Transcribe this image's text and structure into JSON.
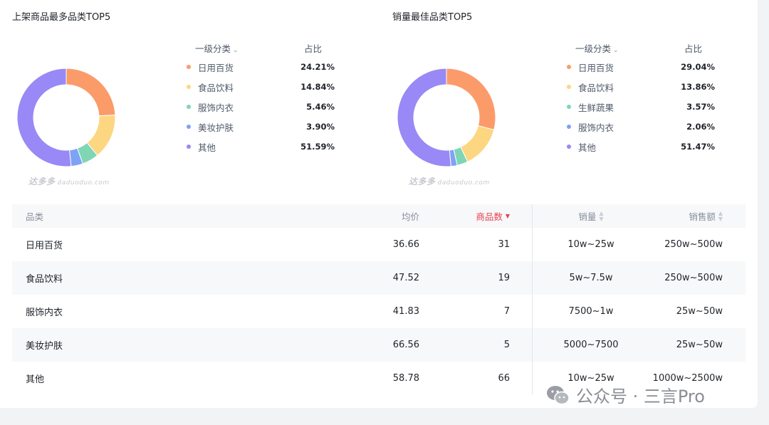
{
  "left_panel": {
    "title": "上架商品最多品类TOP5",
    "legend_header": {
      "category": "一级分类",
      "share": "占比"
    },
    "items": [
      {
        "name": "日用百货",
        "pct": "24.21%",
        "value": 24.21,
        "color": "#fb9b6a"
      },
      {
        "name": "食品饮料",
        "pct": "14.84%",
        "value": 14.84,
        "color": "#fdd682"
      },
      {
        "name": "服饰内衣",
        "pct": "5.46%",
        "value": 5.46,
        "color": "#7ed6b5"
      },
      {
        "name": "美妆护肤",
        "pct": "3.90%",
        "value": 3.9,
        "color": "#7ea3f5"
      },
      {
        "name": "其他",
        "pct": "51.59%",
        "value": 51.59,
        "color": "#9889f6"
      }
    ]
  },
  "right_panel": {
    "title": "销量最佳品类TOP5",
    "legend_header": {
      "category": "一级分类",
      "share": "占比"
    },
    "items": [
      {
        "name": "日用百货",
        "pct": "29.04%",
        "value": 29.04,
        "color": "#fb9b6a"
      },
      {
        "name": "食品饮料",
        "pct": "13.86%",
        "value": 13.86,
        "color": "#fdd682"
      },
      {
        "name": "生鲜蔬果",
        "pct": "3.57%",
        "value": 3.57,
        "color": "#7ed6b5"
      },
      {
        "name": "服饰内衣",
        "pct": "2.06%",
        "value": 2.06,
        "color": "#7ea3f5"
      },
      {
        "name": "其他",
        "pct": "51.47%",
        "value": 51.47,
        "color": "#9889f6"
      }
    ]
  },
  "watermark": {
    "brand": "达多多",
    "domain": "daduoduo.com"
  },
  "table": {
    "headers": {
      "category": "品类",
      "price": "均价",
      "count": "商品数",
      "sales": "销量",
      "amount": "销售额"
    },
    "rows": [
      {
        "category": "日用百货",
        "price": "36.66",
        "count": "31",
        "sales": "10w~25w",
        "amount": "250w~500w"
      },
      {
        "category": "食品饮料",
        "price": "47.52",
        "count": "19",
        "sales": "5w~7.5w",
        "amount": "250w~500w"
      },
      {
        "category": "服饰内衣",
        "price": "41.83",
        "count": "7",
        "sales": "7500~1w",
        "amount": "25w~50w"
      },
      {
        "category": "美妆护肤",
        "price": "66.56",
        "count": "5",
        "sales": "5000~7500",
        "amount": "25w~50w"
      },
      {
        "category": "其他",
        "price": "58.78",
        "count": "66",
        "sales": "10w~25w",
        "amount": "1000w~2500w"
      }
    ]
  },
  "wechat_label": "公众号 · 三言Pro",
  "colors": {
    "sort_active": "#e8414c",
    "header_bg": "#f7f8fa"
  }
}
